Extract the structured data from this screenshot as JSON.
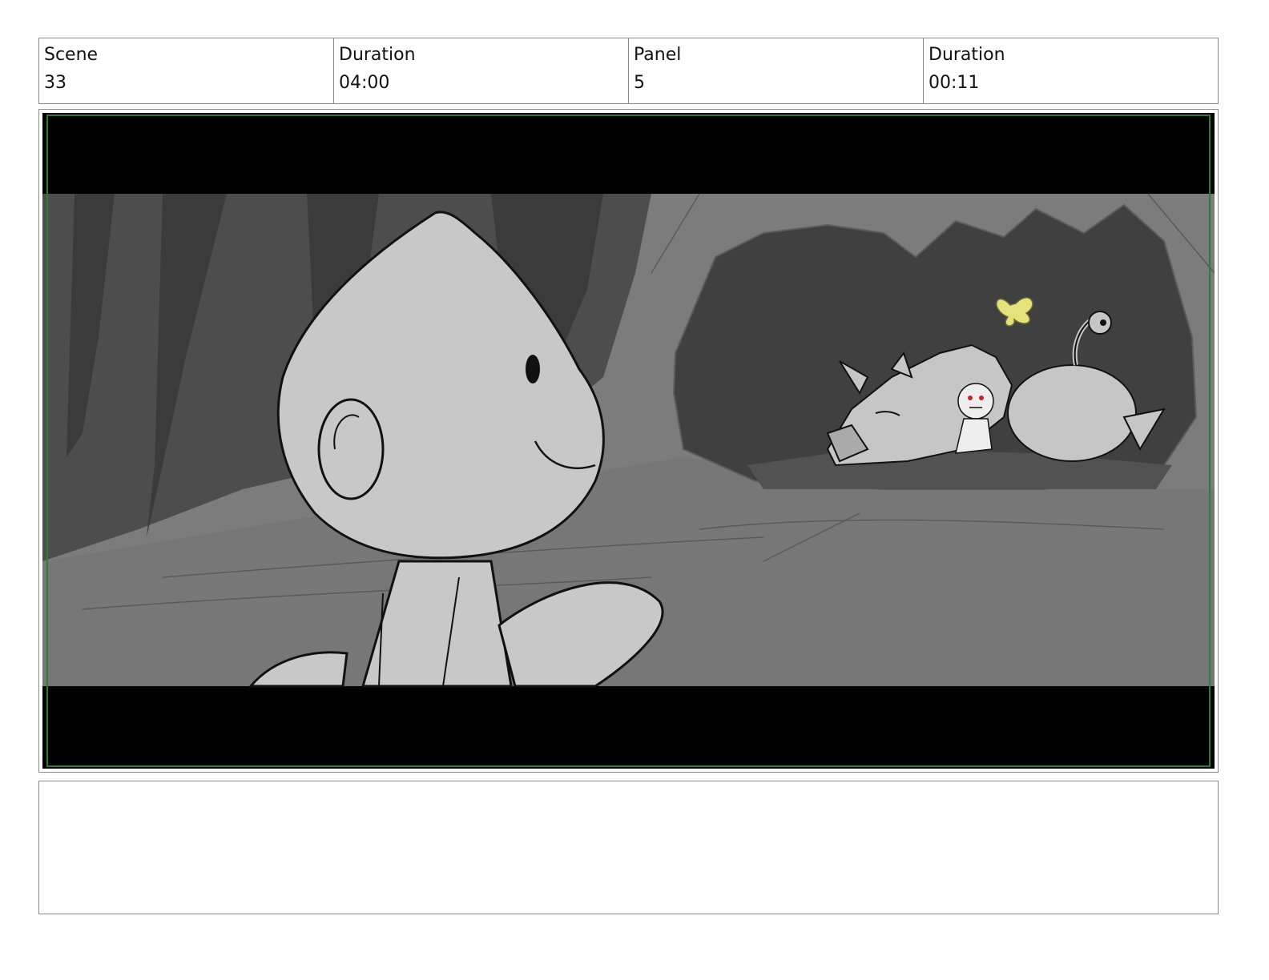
{
  "header": {
    "scene_label": "Scene",
    "scene_value": "33",
    "scene_duration_label": "Duration",
    "scene_duration_value": "04:00",
    "panel_label": "Panel",
    "panel_value": "5",
    "panel_duration_label": "Duration",
    "panel_duration_value": "00:11"
  },
  "panel": {
    "letterbox_color": "#000000",
    "safe_frame_color": "#2e7d32",
    "butterfly_color": "#e6e27a",
    "eye_color": "#cc2222"
  },
  "notes": {
    "text": ""
  }
}
